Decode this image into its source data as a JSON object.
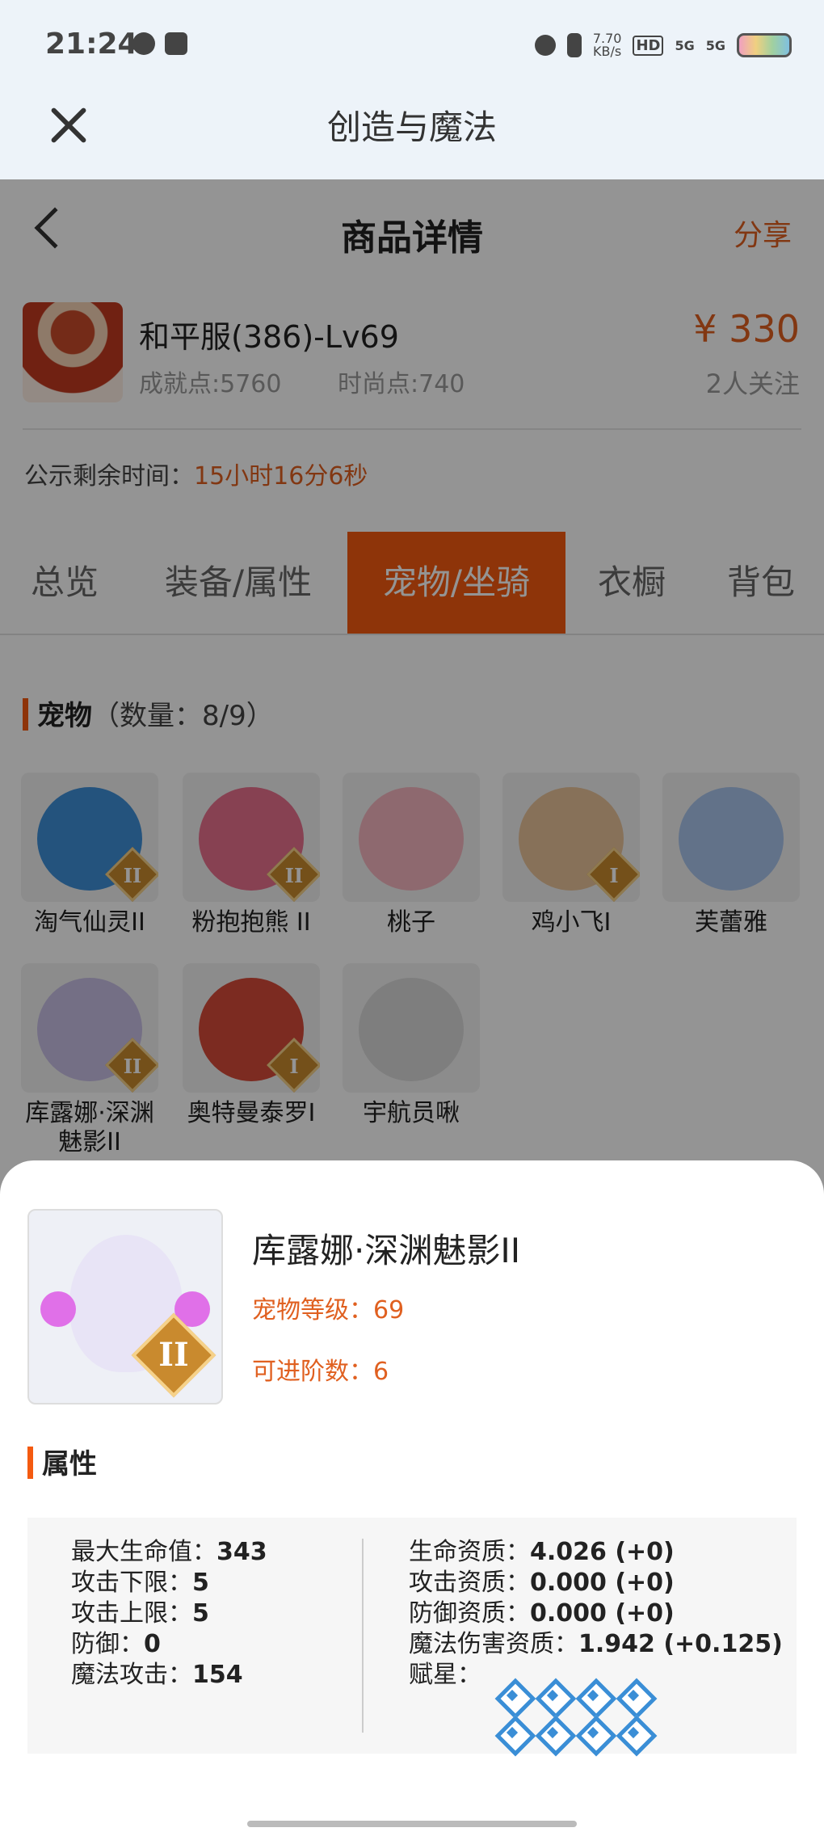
{
  "status_bar": {
    "time": "21:24",
    "net_speed_value": "7.70",
    "net_speed_unit": "KB/s",
    "hd_label": "HD",
    "signal1": "5G",
    "signal2": "5G",
    "icons": [
      "globe-icon",
      "app-icon",
      "alarm-icon",
      "vibrate-icon",
      "hd-icon",
      "signal-icon",
      "signal-icon",
      "battery-icon"
    ]
  },
  "app_bar": {
    "title": "创造与魔法",
    "close_icon": "close-icon"
  },
  "header": {
    "title": "商品详情",
    "share_label": "分享",
    "back_icon": "chevron-left-icon"
  },
  "listing": {
    "account_name": "和平服(386)-Lv69",
    "achievement": "成就点:5760",
    "fashion": "时尚点:740",
    "price": "¥ 330",
    "followers": "2人关注",
    "notice_label": "公示剩余时间：",
    "notice_time": "15小时16分6秒"
  },
  "tabs": [
    {
      "label": "总览"
    },
    {
      "label": "装备/属性"
    },
    {
      "label": "宠物/坐骑",
      "active": true
    },
    {
      "label": "衣橱"
    },
    {
      "label": "背包"
    }
  ],
  "pets_section": {
    "title": "宠物",
    "count": "（数量：8/9）",
    "items": [
      {
        "name": "淘气仙灵II",
        "rank": "II",
        "color": "#3e8fd8"
      },
      {
        "name": "粉抱抱熊 II",
        "rank": "II",
        "color": "#e8708e"
      },
      {
        "name": "桃子",
        "rank": "",
        "color": "#f4b6c0"
      },
      {
        "name": "鸡小飞I",
        "rank": "I",
        "color": "#e9c39a"
      },
      {
        "name": "芙蕾雅",
        "rank": "",
        "color": "#a9c4ec"
      },
      {
        "name": "库露娜·深渊魅影II",
        "rank": "II",
        "color": "#c9bfe6"
      },
      {
        "name": "奥特曼泰罗I",
        "rank": "I",
        "color": "#d64a3a"
      },
      {
        "name": "宇航员啾",
        "rank": "",
        "color": "#dadada"
      }
    ]
  },
  "detail_sheet": {
    "pet_name": "库露娜·深渊魅影II",
    "rank": "II",
    "level": "宠物等级：69",
    "advance": "可进阶数：6",
    "attr_title": "属性",
    "left_attrs": [
      {
        "label": "最大生命值：",
        "value": "343"
      },
      {
        "label": "攻击下限：",
        "value": "5"
      },
      {
        "label": "攻击上限：",
        "value": "5"
      },
      {
        "label": "防御：",
        "value": "0"
      },
      {
        "label": "魔法攻击：",
        "value": "154"
      }
    ],
    "right_attrs": [
      {
        "label": "生命资质：",
        "value": "4.026 (+0)"
      },
      {
        "label": "攻击资质：",
        "value": "0.000 (+0)"
      },
      {
        "label": "防御资质：",
        "value": "0.000 (+0)"
      },
      {
        "label": "魔法伤害资质：",
        "value": "1.942 (+0.125)"
      }
    ],
    "star_label": "赋星：",
    "star_count": 8,
    "star_icon": "diamond-star-icon",
    "accent_color": "#f45a10",
    "star_color": "#3a8ed6"
  }
}
